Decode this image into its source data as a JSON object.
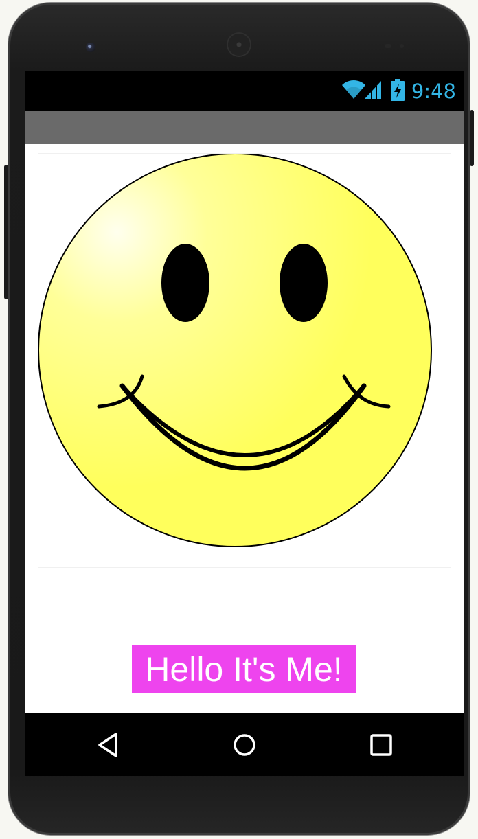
{
  "status_bar": {
    "time": "9:48",
    "icons": [
      "wifi-icon",
      "cellular-signal-icon",
      "battery-charging-icon"
    ]
  },
  "content": {
    "image": "smiley-face-icon",
    "label": "Hello It's Me!",
    "label_background": "#EE44EE",
    "label_text_color": "#FFFFFF"
  },
  "navigation": {
    "buttons": [
      "back-icon",
      "home-icon",
      "recents-icon"
    ]
  },
  "colors": {
    "status_time": "#33B5E5",
    "action_bar": "#6A6A6A",
    "face_yellow": "#FFFF5C"
  }
}
